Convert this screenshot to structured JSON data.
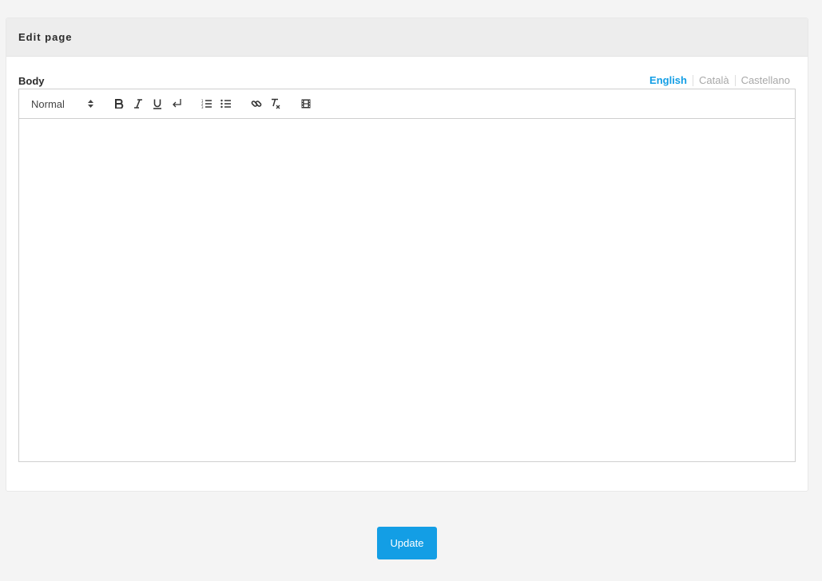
{
  "card": {
    "title": "Edit page"
  },
  "field": {
    "label": "Body",
    "languages": [
      {
        "label": "English",
        "active": true
      },
      {
        "label": "Català",
        "active": false
      },
      {
        "label": "Castellano",
        "active": false
      }
    ]
  },
  "toolbar": {
    "format_value": "Normal",
    "buttons": [
      "bold-icon",
      "italic-icon",
      "underline-icon",
      "line-break-icon",
      "ordered-list-icon",
      "bullet-list-icon",
      "link-icon",
      "clear-format-icon",
      "video-icon"
    ]
  },
  "editor": {
    "content": ""
  },
  "actions": {
    "update_label": "Update"
  },
  "colors": {
    "accent": "#139ee5",
    "background": "#f4f4f4",
    "header_bg": "#ededed"
  }
}
